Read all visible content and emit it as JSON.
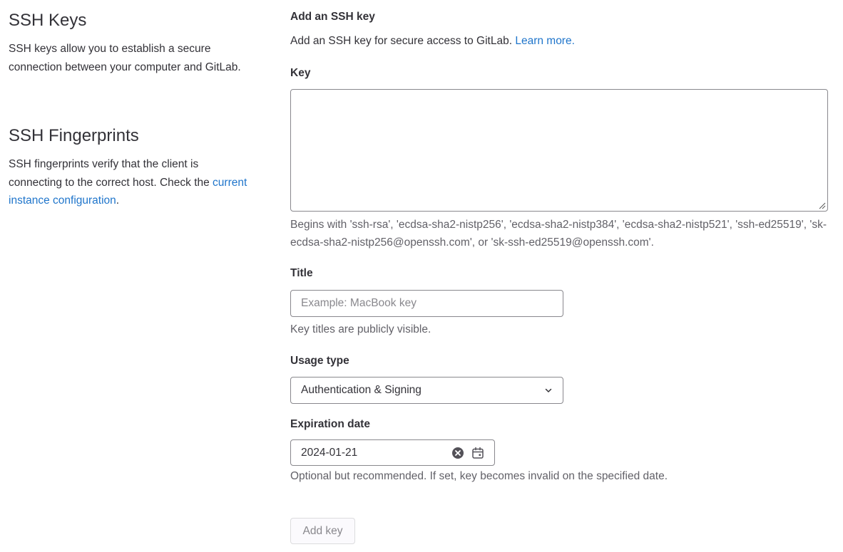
{
  "sidebar": {
    "ssh_keys": {
      "title": "SSH Keys",
      "description": "SSH keys allow you to establish a secure connection between your computer and GitLab."
    },
    "ssh_fingerprints": {
      "title": "SSH Fingerprints",
      "description_prefix": "SSH fingerprints verify that the client is connecting to the correct host. Check the ",
      "link_text": "current instance configuration",
      "description_suffix": "."
    }
  },
  "form": {
    "heading": "Add an SSH key",
    "intro": "Add an SSH key for secure access to GitLab. ",
    "learn_more": "Learn more.",
    "key": {
      "label": "Key",
      "value": "",
      "help": "Begins with 'ssh-rsa', 'ecdsa-sha2-nistp256', 'ecdsa-sha2-nistp384', 'ecdsa-sha2-nistp521', 'ssh-ed25519', 'sk-ecdsa-sha2-nistp256@openssh.com', or 'sk-ssh-ed25519@openssh.com'."
    },
    "title": {
      "label": "Title",
      "placeholder": "Example: MacBook key",
      "help": "Key titles are publicly visible."
    },
    "usage_type": {
      "label": "Usage type",
      "selected": "Authentication & Signing"
    },
    "expiration": {
      "label": "Expiration date",
      "value": "2024-01-21",
      "help": "Optional but recommended. If set, key becomes invalid on the specified date."
    },
    "submit_label": "Add key"
  },
  "icons": {
    "clear": "clear-icon",
    "calendar": "calendar-icon",
    "chevron": "chevron-down-icon",
    "resize": "resize-handle-icon"
  },
  "colors": {
    "link": "#1f75cb",
    "text": "#333238",
    "muted": "#626168",
    "border": "#89888d"
  }
}
